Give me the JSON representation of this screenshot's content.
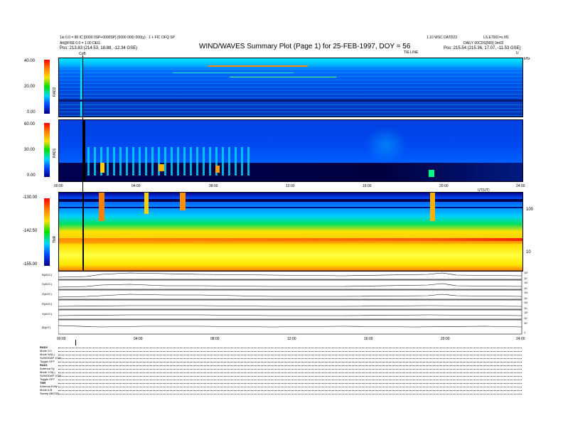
{
  "header": {
    "title": "WIND/WAVES Summary Plot (Page 1) for 25-FEB-1997, DOY = 56",
    "left_line1": "1st 0.0 = 80 IC [0000 0SP+0000SP] (0000 000) 000(y) · 1 + FIC OFQ SP",
    "left_line2": "Alt@FRE 0.0 = 1.00 DEG",
    "left_line3": "Pos: 213.83 (214.53, 18.88, -12.34 GSE)",
    "right_line1": "1.10 WSC DATD23",
    "right_line2": "LS.E7001=x.0f1",
    "right_line3": "DAILY 00CDS[000] 3m02",
    "right_line4": "Pos: 215.54 (215.36, 17.07, -11.53 GSE)",
    "top_right_unit": "kHz",
    "top_right_u": "U",
    "top_center_tag": "TIE LINE"
  },
  "panels": {
    "rad2": {
      "name": "RAD2",
      "ticks": [
        "40.00",
        "20.00",
        "0.00"
      ]
    },
    "rad1": {
      "name": "RAD1",
      "ticks": [
        "60.00",
        "30.00",
        "0.00"
      ]
    },
    "tnr": {
      "name": "TNR",
      "ticks": [
        "-130.00",
        "-142.50",
        "-155.00"
      ],
      "right_ticks": [
        "100",
        "10"
      ]
    }
  },
  "marker_label": "CoB",
  "time_axis": {
    "ticks": [
      "00:00",
      "04:00",
      "08:00",
      "12:00",
      "16:00",
      "20:00",
      "24:00"
    ],
    "right_label": "UT(UT)"
  },
  "traces": [
    {
      "name": "B(AGC)",
      "right": [
        "100",
        "10"
      ]
    },
    {
      "name": "S(AGC)",
      "right": [
        "100",
        "10"
      ]
    },
    {
      "name": "Z(AGC)",
      "right": [
        "100",
        "10"
      ]
    },
    {
      "name": "R(AGC)",
      "right": [
        "100",
        "10"
      ]
    },
    {
      "name": "X(AGC)",
      "right": [
        "100",
        "10"
      ]
    },
    {
      "name": "|B|(nT)",
      "right": [
        "10",
        "1"
      ]
    }
  ],
  "bottom_axis": {
    "ticks": [
      "00:00",
      "04:00",
      "08:00",
      "12:00",
      "16:00",
      "20:00",
      "24:00"
    ]
  },
  "footer": [
    "RAD2",
    "Mode    2:0",
    "Mode    IW(L)",
    "SUMODAP 1024",
    "Toggle  OFF",
    "RAD1",
    "Antenna   Sy",
    "Mode  1:0(L)",
    "SUMODAP 1024",
    "Toggle  OFF",
    "TNR",
    "Antenna  Exfly",
    "Mode   A:B",
    "Sweep  ABCDE"
  ],
  "colors": {
    "bg": "#0033cc",
    "deep": "#000066",
    "cyan": "#00d8ff",
    "green": "#00e000",
    "yellow": "#ffe000",
    "orange": "#ff8000",
    "red": "#ff0000"
  }
}
